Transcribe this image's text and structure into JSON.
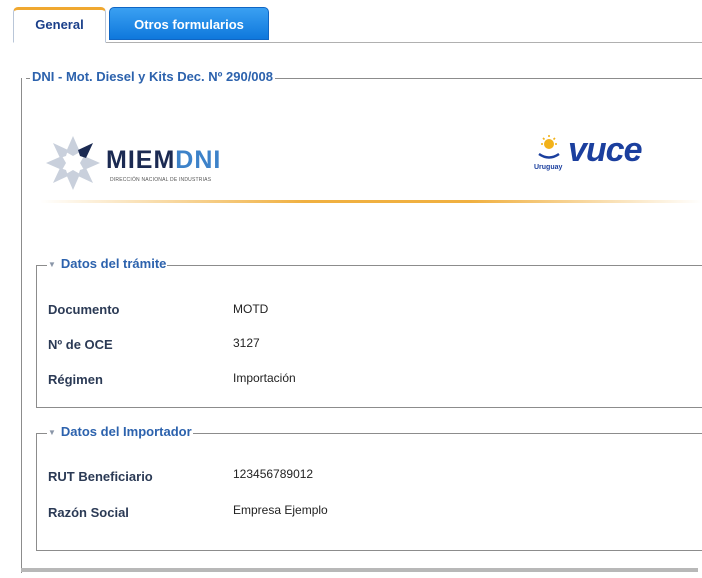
{
  "tabs": [
    {
      "label": "General",
      "active": true
    },
    {
      "label": "Otros formularios",
      "active": false
    }
  ],
  "form": {
    "legend": "DNI - Mot. Diesel y Kits Dec. Nº 290/008"
  },
  "banner": {
    "miem_text": "MIEM",
    "dni_text": "DNI",
    "miem_subtitle": "DIRECCIÓN NACIONAL DE INDUSTRIAS",
    "vuce_text": "vuce",
    "uruguay_text": "Uruguay"
  },
  "sections": {
    "tramite": {
      "title": "Datos del trámite",
      "rows": [
        {
          "label": "Documento",
          "value": "MOTD"
        },
        {
          "label": "Nº de OCE",
          "value": "3127"
        },
        {
          "label": "Régimen",
          "value": "Importación"
        }
      ]
    },
    "importador": {
      "title": "Datos del Importador",
      "rows": [
        {
          "label": "RUT Beneficiario",
          "value": "123456789012"
        },
        {
          "label": "Razón Social",
          "value": "Empresa Ejemplo"
        }
      ]
    }
  },
  "colors": {
    "tab_active_border": "#f0a830",
    "tab_blue": "#1478dc",
    "legend_blue": "#2c62ad",
    "label_dark": "#2b3a55"
  }
}
